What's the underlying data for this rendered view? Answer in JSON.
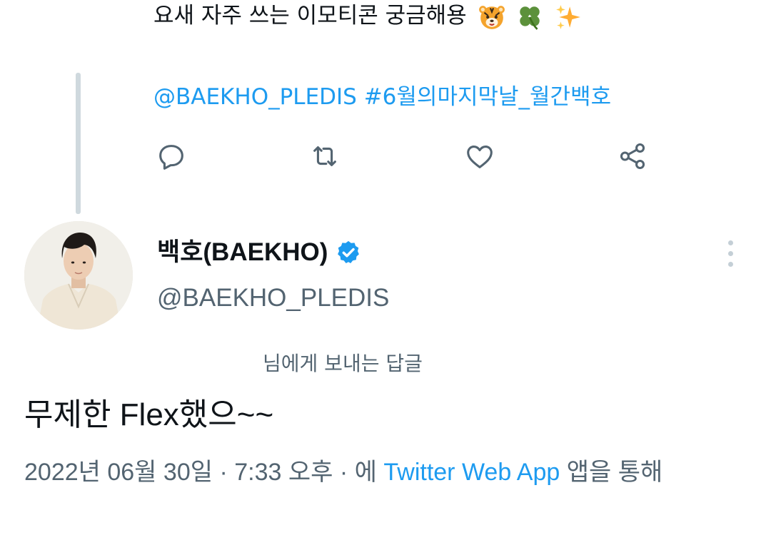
{
  "previous_tweet": {
    "text": "요새 자주 쓰는 이모티콘 궁금해용",
    "emojis": [
      "tiger-face-icon",
      "four-leaf-clover-icon",
      "sparkles-icon"
    ],
    "mention": "@BAEKHO_PLEDIS",
    "hashtag": "#6월의마지막날_월간백호",
    "actions": [
      "reply-icon",
      "retweet-icon",
      "like-icon",
      "share-icon"
    ]
  },
  "tweet": {
    "display_name": "백호(BAEKHO)",
    "handle": "@BAEKHO_PLEDIS",
    "verified": true,
    "reply_context": "님에게 보내는 답글",
    "text": "무제한 Flex했으~~",
    "meta": {
      "date": "2022년 06월 30일",
      "sep1": " · ",
      "time": "7:33 오후",
      "sep2": " · ",
      "via_prefix": "에 ",
      "source": "Twitter Web App",
      "via_suffix": " 앱을 통해"
    }
  },
  "colors": {
    "link": "#1d9bf0",
    "secondary_text": "#536471",
    "primary_text": "#0f1419",
    "thread_line": "#cfd9de",
    "verified_badge": "#1d9bf0"
  }
}
